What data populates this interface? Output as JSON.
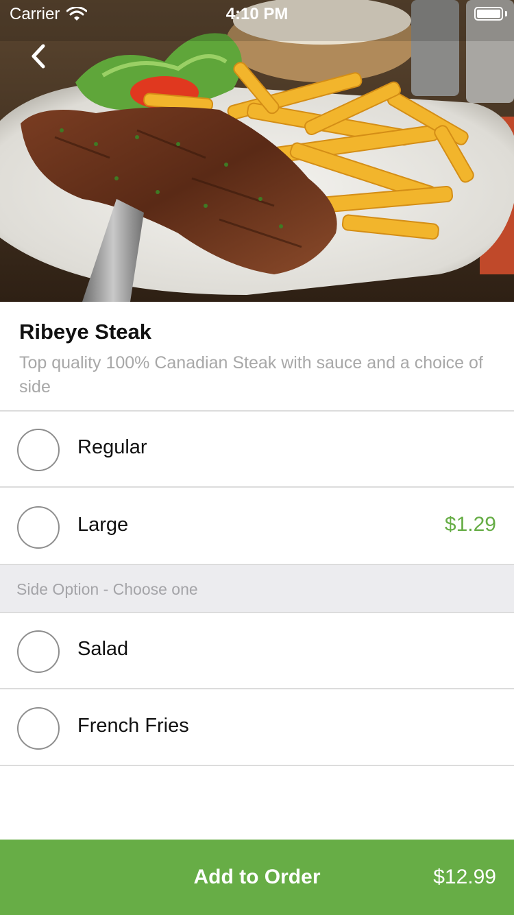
{
  "status_bar": {
    "carrier": "Carrier",
    "time": "4:10 PM",
    "icons": [
      "wifi-icon",
      "battery-icon"
    ]
  },
  "hero": {
    "image": "steak-and-fries-photo",
    "back_icon": "chevron-left-icon"
  },
  "item": {
    "title": "Ribeye Steak",
    "description": "Top quality 100% Canadian Steak with sauce and a choice of side"
  },
  "size_options": [
    {
      "label": "Regular",
      "price": "",
      "selected": false
    },
    {
      "label": "Large",
      "price": "$1.29",
      "selected": false
    }
  ],
  "side_section": {
    "label": "Side Option - Choose one"
  },
  "side_options": [
    {
      "label": "Salad",
      "selected": false
    },
    {
      "label": "French Fries",
      "selected": false
    }
  ],
  "add_to_order": {
    "label": "Add to Order",
    "price": "$12.99"
  },
  "colors": {
    "accent_green": "#67ad46",
    "price_green": "#66ad46",
    "section_bg": "#ececef",
    "muted_text": "#a8a8a8"
  }
}
